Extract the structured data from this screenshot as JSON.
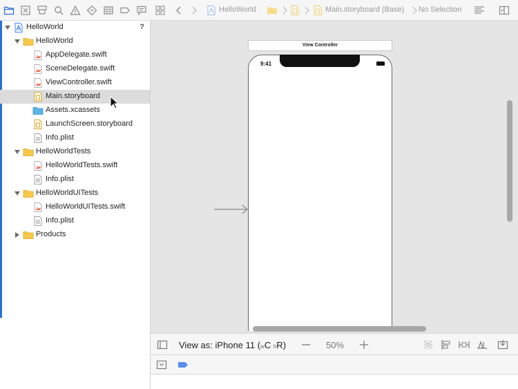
{
  "navigator": {
    "toolbar_icons": [
      "folder-icon",
      "source-control-icon",
      "symbol-icon",
      "find-icon",
      "issue-icon",
      "test-icon",
      "debug-icon",
      "breakpoint-icon",
      "report-icon"
    ],
    "tree": [
      {
        "label": "HelloWorld",
        "icon": "project-icon",
        "badge": "?",
        "expanded": true
      },
      {
        "label": "HelloWorld",
        "icon": "folder-icon",
        "expanded": true
      },
      {
        "label": "AppDelegate.swift",
        "icon": "swift-file-icon"
      },
      {
        "label": "SceneDelegate.swift",
        "icon": "swift-file-icon"
      },
      {
        "label": "ViewController.swift",
        "icon": "swift-file-icon"
      },
      {
        "label": "Main.storyboard",
        "icon": "storyboard-file-icon",
        "selected": true
      },
      {
        "label": "Assets.xcassets",
        "icon": "assets-folder-icon"
      },
      {
        "label": "LaunchScreen.storyboard",
        "icon": "storyboard-file-icon"
      },
      {
        "label": "Info.plist",
        "icon": "plist-file-icon"
      },
      {
        "label": "HelloWorldTests",
        "icon": "folder-icon",
        "expanded": true
      },
      {
        "label": "HelloWorldTests.swift",
        "icon": "swift-file-icon"
      },
      {
        "label": "Info.plist",
        "icon": "plist-file-icon"
      },
      {
        "label": "HelloWorldUITests",
        "icon": "folder-icon",
        "expanded": true
      },
      {
        "label": "HelloWorldUITests.swift",
        "icon": "swift-file-icon"
      },
      {
        "label": "Info.plist",
        "icon": "plist-file-icon"
      },
      {
        "label": "Products",
        "icon": "folder-icon",
        "expanded": false
      }
    ]
  },
  "jumpbar": {
    "project": "HelloWorld",
    "file": "Main.storyboard (Base)",
    "selection": "No Selection"
  },
  "canvas": {
    "scene_title": "View Controller",
    "status_time": "9:41"
  },
  "bottom_bar": {
    "view_as_prefix": "View as: iPhone 11 (",
    "w_small": "w",
    "w_class": "C",
    "h_small": "h",
    "h_class": "R",
    "suffix": ")",
    "zoom": "50%"
  },
  "colors": {
    "accent": "#2c6fd6",
    "swift": "#f05138",
    "folder": "#f7c948",
    "canvas": "#e5e5e5"
  }
}
